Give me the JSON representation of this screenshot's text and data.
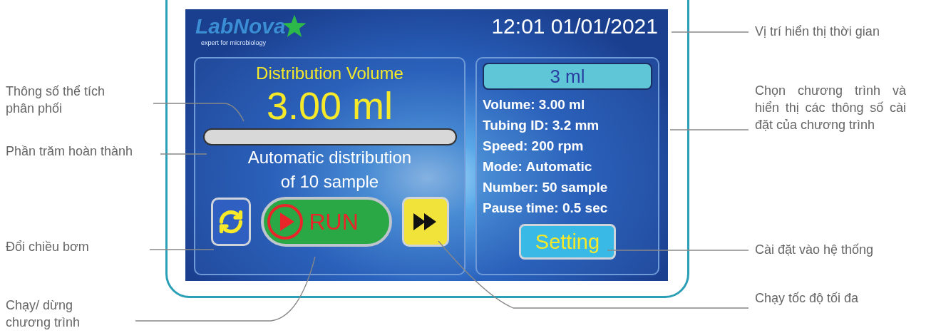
{
  "annotations_left": [
    "Thông số thể tích phân phối",
    "Phần trăm hoàn thành",
    "Đổi chiều bơm",
    "Chạy/ dừng chương trình"
  ],
  "screen": {
    "logo": {
      "name": "LabNova",
      "tagline": "expert for microbiology"
    },
    "clock": "12:01 01/01/2021",
    "distribution": {
      "title": "Distribution Volume",
      "value": "3.00 ml",
      "progress": {
        "level": 0
      },
      "status_lines": [
        "Automatic distribution",
        "of 10 sample"
      ],
      "run_button": {
        "label": "RUN"
      }
    },
    "program": {
      "selected_program": "3 ml",
      "params": [
        "Volume: 3.00 ml",
        "Tubing ID: 3.2 mm",
        "Speed: 200 rpm",
        "Mode: Automatic",
        "Number: 50 sample",
        "Pause time: 0.5 sec"
      ],
      "setting_button": "Setting"
    }
  },
  "annotations_right": [
    "Vị trí hiển thị thời gian",
    "Chọn chương trình và hiển thị các thông số cài đặt của chương trình",
    "Cài đặt vào hệ thống",
    "Chạy tốc độ tối đa"
  ]
}
